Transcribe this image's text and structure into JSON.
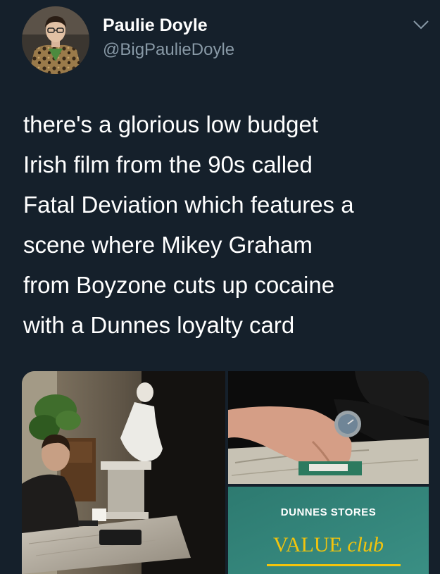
{
  "author": {
    "display_name": "Paulie Doyle",
    "handle": "@BigPaulieDoyle"
  },
  "menu": {
    "icon": "chevron-down-icon"
  },
  "tweet": {
    "lines": [
      "there's a glorious low budget",
      "Irish film from the 90s called",
      "Fatal Deviation which features a",
      "scene where Mikey Graham",
      "from Boyzone cuts up cocaine",
      "with a Dunnes loyalty card"
    ]
  },
  "media": {
    "card": {
      "title": "DUNNES STORES",
      "brand_main": "VALUE",
      "brand_italic": "club"
    }
  },
  "colors": {
    "background": "#15202b",
    "secondary_text": "#8899a6",
    "card_green": "#2f7f73",
    "card_gold": "#f2c40d"
  }
}
